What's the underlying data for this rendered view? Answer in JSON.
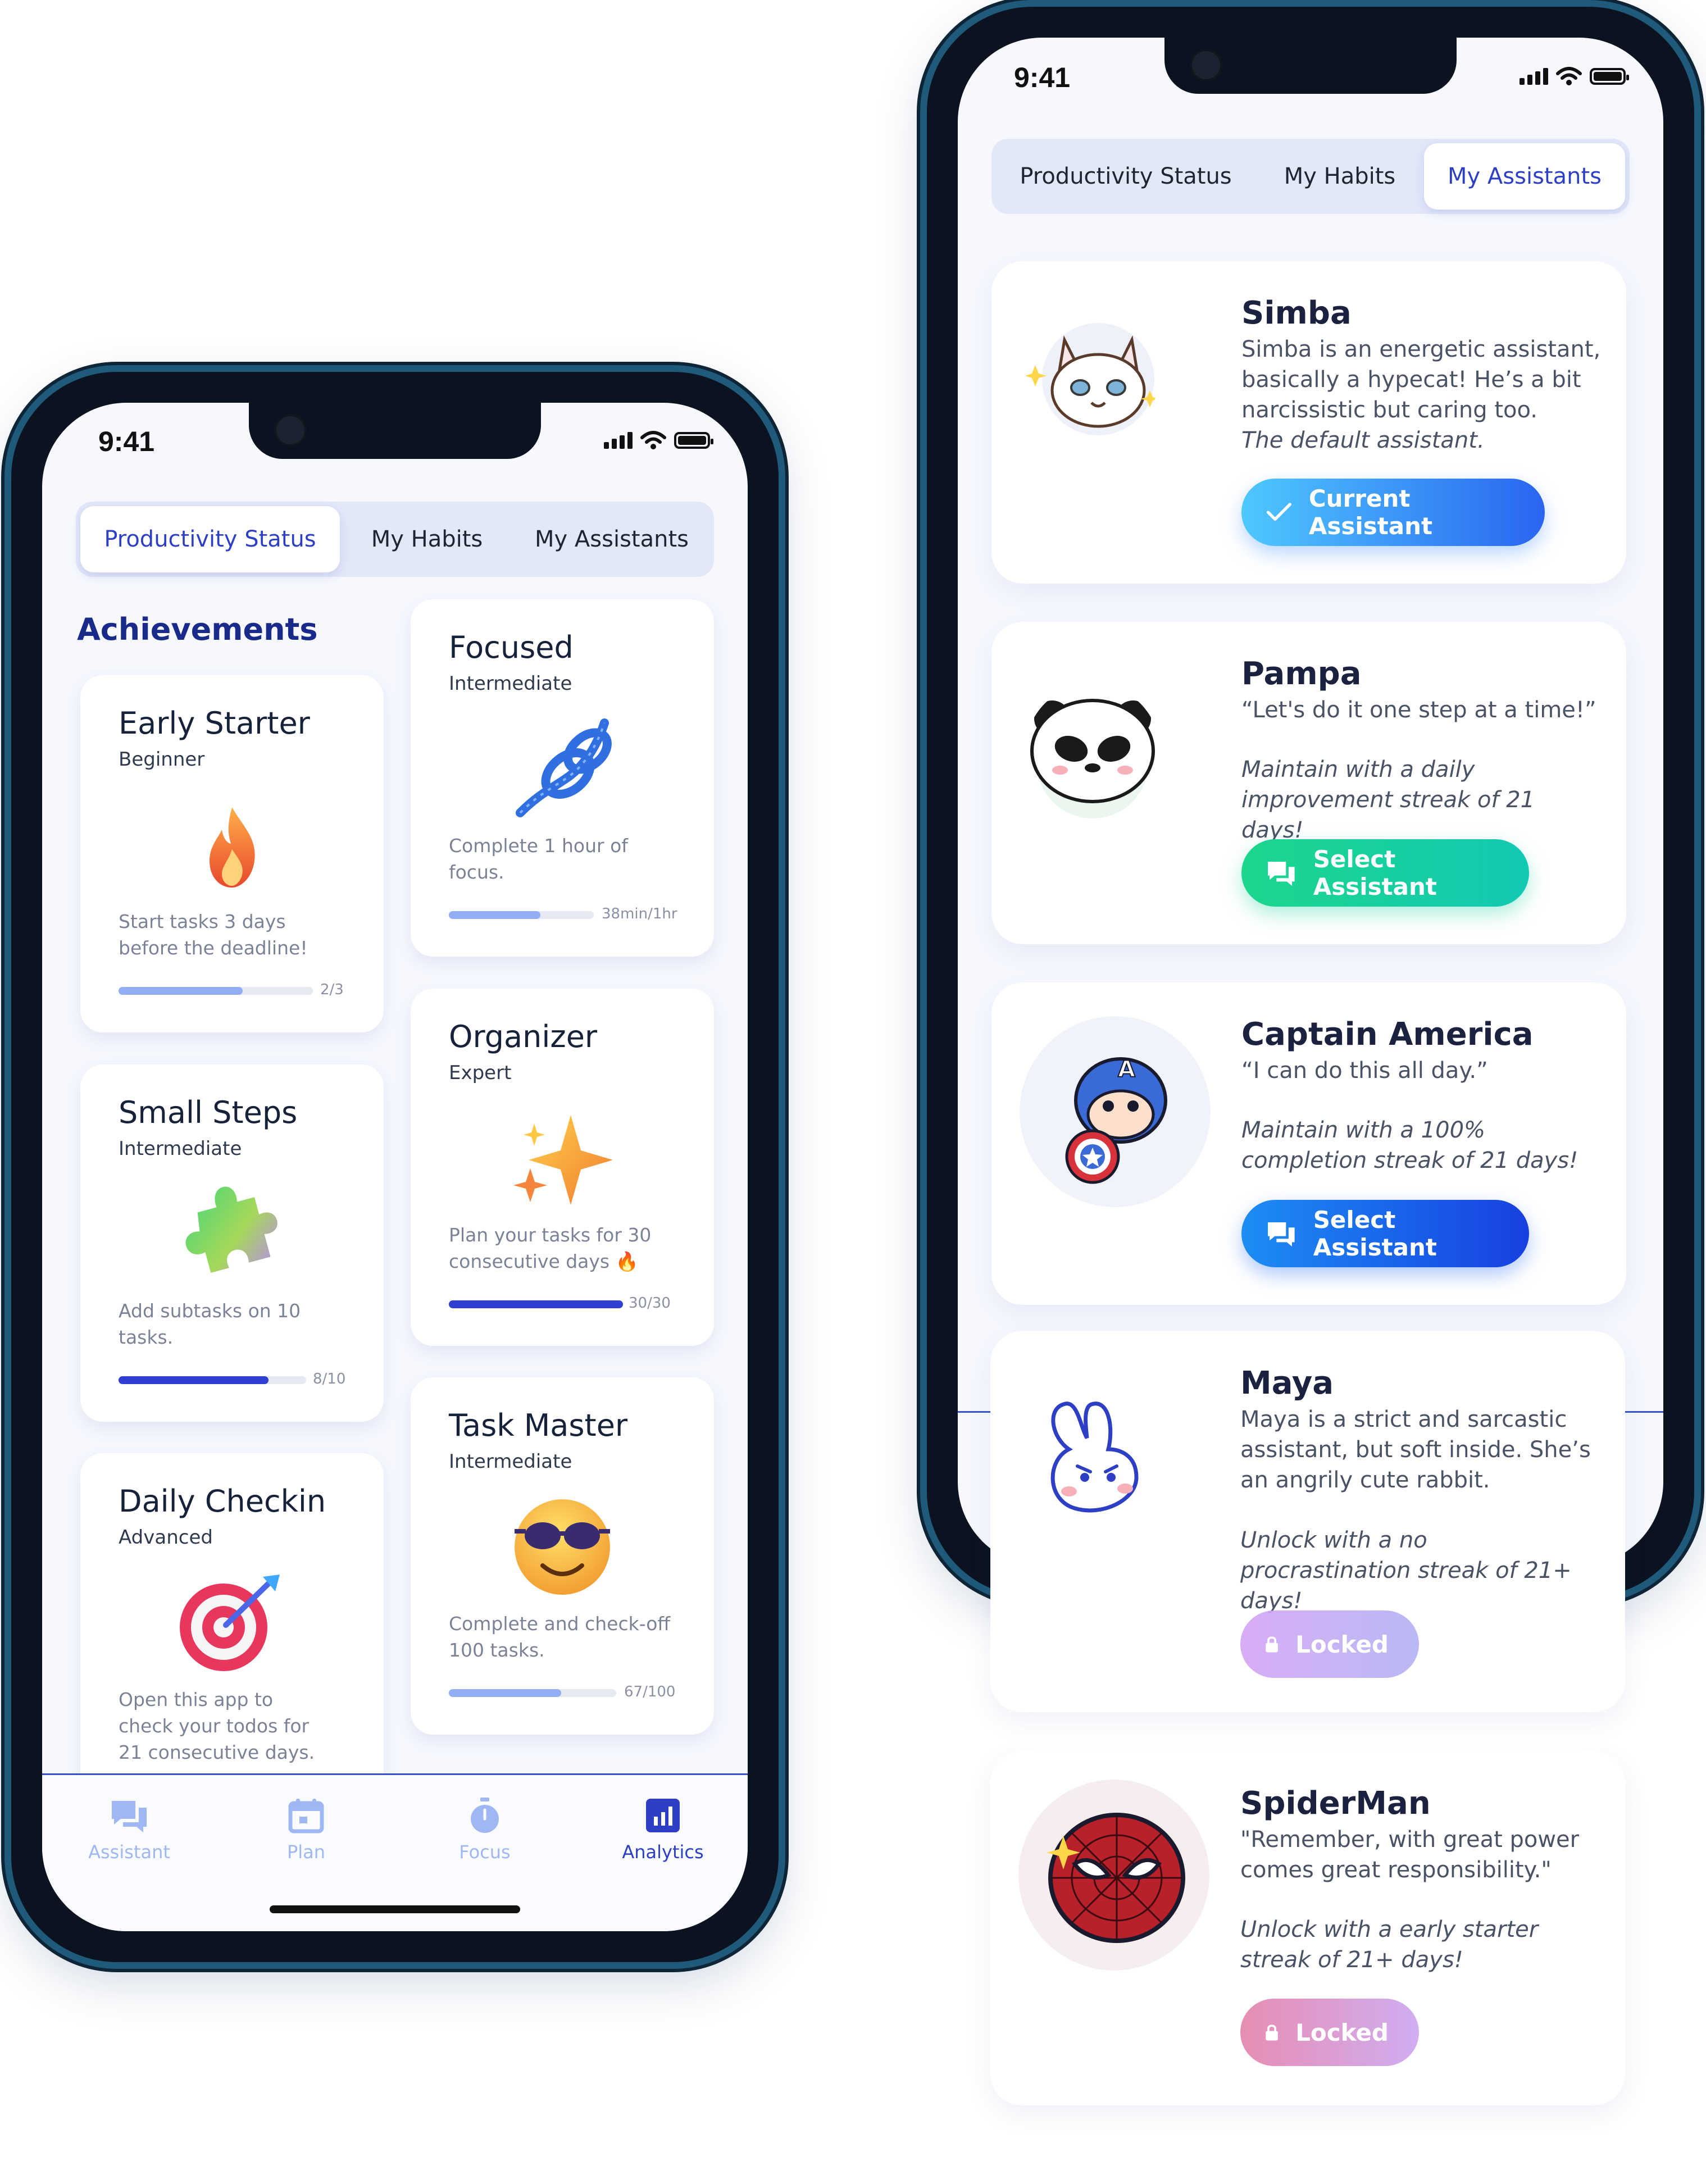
{
  "left_phone": {
    "status_bar": {
      "time": "9:41"
    },
    "tabs": [
      {
        "label": "Productivity Status",
        "active": true
      },
      {
        "label": "My Habits",
        "active": false
      },
      {
        "label": "My Assistants",
        "active": false
      }
    ],
    "section_title": "Achievements",
    "achievements": {
      "early_starter": {
        "title": "Early Starter",
        "level": "Beginner",
        "description": "Start tasks 3 days before the deadline!",
        "progress_text": "2/3",
        "progress": 0.64,
        "color": "#93aef5",
        "icon": "fire-icon"
      },
      "small_steps": {
        "title": "Small Steps",
        "level": "Intermediate",
        "description": "Add subtasks on 10 tasks.",
        "progress_text": "8/10",
        "progress": 0.8,
        "color": "#2f3fd1",
        "icon": "puzzle-icon"
      },
      "daily_checkin": {
        "title": "Daily Checkin",
        "level": "Advanced",
        "description": "Open this app to check your todos for 21 consecutive days.",
        "icon": "target-icon"
      },
      "focused": {
        "title": "Focused",
        "level": "Intermediate",
        "description": "Complete 1 hour of focus.",
        "progress_text": "38min/1hr",
        "progress": 0.63,
        "color": "#93aef5",
        "icon": "knot-icon"
      },
      "organizer": {
        "title": "Organizer",
        "level": "Expert",
        "description": "Plan your tasks for 30 consecutive days 🔥",
        "progress_text": "30/30",
        "progress": 1.0,
        "color": "#2f3fd1",
        "icon": "sparkles-icon"
      },
      "task_master": {
        "title": "Task Master",
        "level": "Intermediate",
        "description": "Complete and check-off 100 tasks.",
        "progress_text": "67/100",
        "progress": 0.67,
        "color": "#93aef5",
        "icon": "sunglasses-face-icon"
      }
    },
    "bottom_nav": [
      {
        "label": "Assistant",
        "icon": "chat-icon",
        "active": false
      },
      {
        "label": "Plan",
        "icon": "calendar-icon",
        "active": false
      },
      {
        "label": "Focus",
        "icon": "stopwatch-icon",
        "active": false
      },
      {
        "label": "Analytics",
        "icon": "chart-icon",
        "active": true
      }
    ]
  },
  "right_phone": {
    "status_bar": {
      "time": "9:41"
    },
    "tabs": [
      {
        "label": "Productivity Status",
        "active": false
      },
      {
        "label": "My Habits",
        "active": false
      },
      {
        "label": "My Assistants",
        "active": true
      }
    ],
    "assistants": {
      "simba": {
        "name": "Simba",
        "description": "Simba is an energetic assistant, basically a hypecat! He’s a bit narcissistic but caring too.",
        "note": "The default assistant.",
        "button": "Current Assistant",
        "state": "current",
        "avatar": "cat-avatar-icon"
      },
      "pampa": {
        "name": "Pampa",
        "description": "“Let's do it one step at a time!”",
        "note": "Maintain with a daily improvement streak of 21 days!",
        "button": "Select Assistant",
        "state": "available",
        "avatar": "panda-avatar-icon"
      },
      "captain_america": {
        "name": "Captain America",
        "description": "“I can do this all day.”",
        "note": "Maintain with a 100% completion streak of 21 days!",
        "button": "Select Assistant",
        "state": "available",
        "avatar": "captain-america-avatar-icon"
      },
      "maya": {
        "name": "Maya",
        "description": "Maya is a strict and sarcastic assistant, but soft inside. She’s an angrily cute rabbit.",
        "note": "Unlock with a no procrastination streak of 21+ days!",
        "button": "Locked",
        "state": "locked",
        "avatar": "rabbit-avatar-icon"
      },
      "spiderman": {
        "name": "SpiderMan",
        "description": "\"Remember, with great power comes great responsibility.\"",
        "note": "Unlock with a early starter streak of 21+ days!",
        "button": "Locked",
        "state": "locked",
        "avatar": "spiderman-avatar-icon"
      }
    }
  }
}
